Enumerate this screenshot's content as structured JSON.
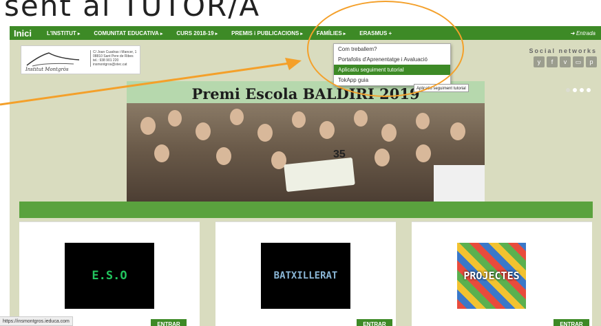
{
  "slide": {
    "title": "sent al TUTOR/A"
  },
  "nav": {
    "home": "Inici",
    "items": [
      {
        "label": "L'INSTITUT",
        "caret": "▸"
      },
      {
        "label": "COMUNITAT EDUCATIVA",
        "caret": "▸"
      },
      {
        "label": "CURS 2018-19",
        "caret": "▸"
      },
      {
        "label": "PREMIS i PUBLICACIONS",
        "caret": "▸"
      },
      {
        "label": "FAMÍLIES",
        "caret": "▸"
      },
      {
        "label": "ERASMUS +",
        "caret": ""
      }
    ],
    "login": "Entrada"
  },
  "logo": {
    "name": "Institut Montgròs",
    "address": "C/ Joan Cuadras i Mancer, 1\n08810 Sant Pere de Ribes\ntel.: 938 901 220\ninsmontgros@xtec.cat"
  },
  "social": {
    "title": "Social networks",
    "icons": [
      "y",
      "f",
      "v",
      "▭",
      "p"
    ]
  },
  "dropdown": {
    "items": [
      {
        "label": "Com treballem?",
        "active": false
      },
      {
        "label": "Portafolis d'Aprenentatge i Avaluació",
        "active": false
      },
      {
        "label": "Aplicatiu seguiment tutorial",
        "active": true
      },
      {
        "label": "TokApp guia",
        "active": false
      }
    ],
    "tooltip": "Aplicatiu seguiment tutorial"
  },
  "hero": {
    "title": "Premi Escola BALDIRI 2019",
    "banner_number": "35"
  },
  "cards": [
    {
      "image_text": "E.S.O",
      "image_color": "#22c55e",
      "button": "ENTRAR"
    },
    {
      "image_text": "BATXILLERAT",
      "image_color": "#8ab6d6",
      "button": "ENTRAR"
    },
    {
      "image_text": "PROJECTES",
      "image_color": "#ffffff",
      "button": "ENTRAR"
    }
  ],
  "status_bar": {
    "url": "https://insmontgros.ieduca.com"
  },
  "colors": {
    "nav_green": "#3d8a26",
    "highlight_orange": "#f4a02a",
    "page_bg": "#d9dcbf"
  }
}
